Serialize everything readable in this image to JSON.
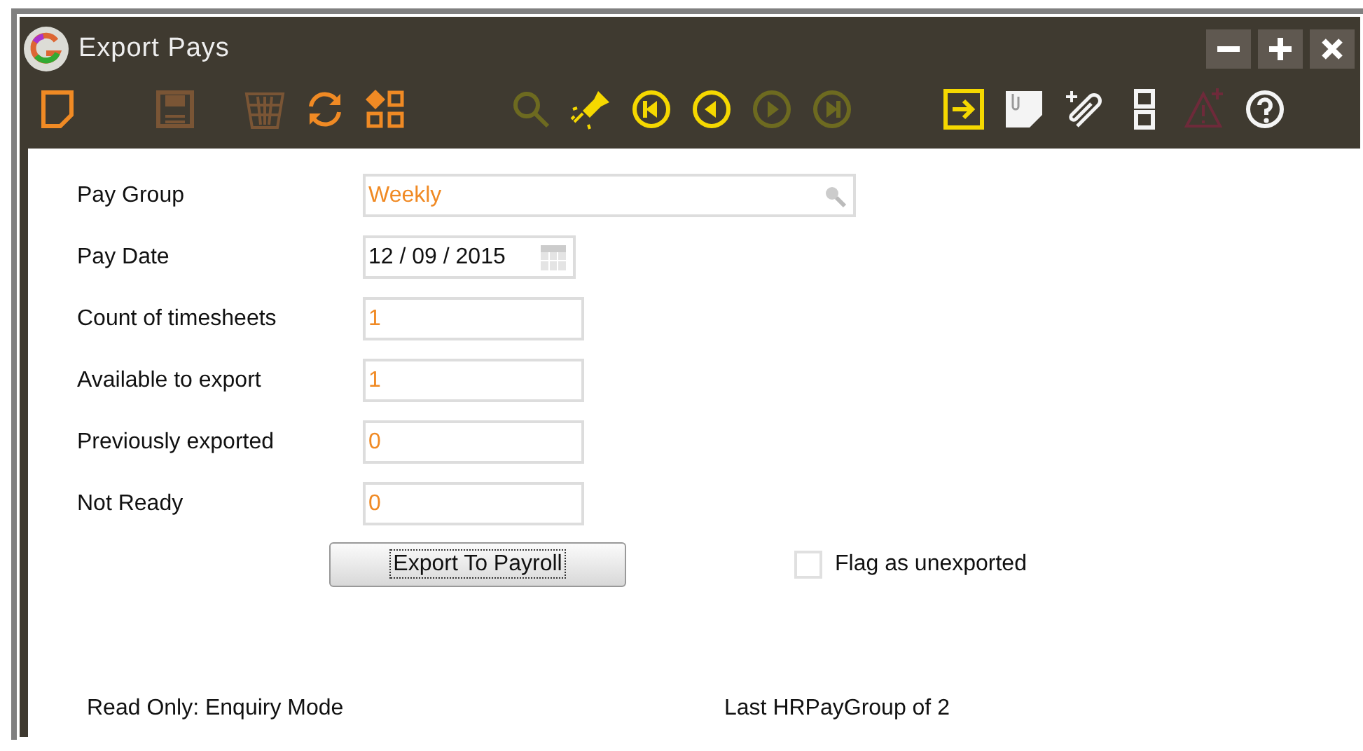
{
  "window": {
    "title": "Export Pays"
  },
  "toolbar_groups": [
    [
      {
        "kind": "new",
        "enabled": true
      }
    ],
    [
      {
        "kind": "save",
        "enabled": false
      }
    ],
    [
      {
        "kind": "delete",
        "enabled": false
      },
      {
        "kind": "refresh",
        "enabled": true
      },
      {
        "kind": "group",
        "enabled": true
      }
    ],
    [
      {
        "kind": "search",
        "enabled": false
      },
      {
        "kind": "flashlight",
        "enabled": true
      },
      {
        "kind": "first",
        "enabled": true
      },
      {
        "kind": "previous",
        "enabled": true
      },
      {
        "kind": "next",
        "enabled": false
      },
      {
        "kind": "last",
        "enabled": false
      }
    ],
    [
      {
        "kind": "export",
        "enabled": true
      },
      {
        "kind": "note",
        "enabled": true
      },
      {
        "kind": "attach",
        "enabled": true
      },
      {
        "kind": "layout",
        "enabled": true
      },
      {
        "kind": "warning",
        "enabled": false
      },
      {
        "kind": "help",
        "enabled": true
      }
    ]
  ],
  "fields": [
    {
      "label": "Pay Group",
      "value": "Weekly",
      "kind": "lookup"
    },
    {
      "label": "Pay Date",
      "value": "12 / 09 / 2015",
      "kind": "date"
    },
    {
      "label": "Count of timesheets",
      "value": "1",
      "kind": "number"
    },
    {
      "label": "Available to export",
      "value": "1",
      "kind": "number"
    },
    {
      "label": "Previously exported",
      "value": "0",
      "kind": "number"
    },
    {
      "label": "Not Ready",
      "value": "0",
      "kind": "number"
    }
  ],
  "export_button": {
    "label": "Export To Payroll",
    "focused": true
  },
  "flag_checkbox": {
    "label": "Flag as unexported",
    "checked": false
  },
  "status_bar": {
    "mode": "Read Only: Enquiry Mode",
    "record": "Last HRPayGroup of 2"
  }
}
